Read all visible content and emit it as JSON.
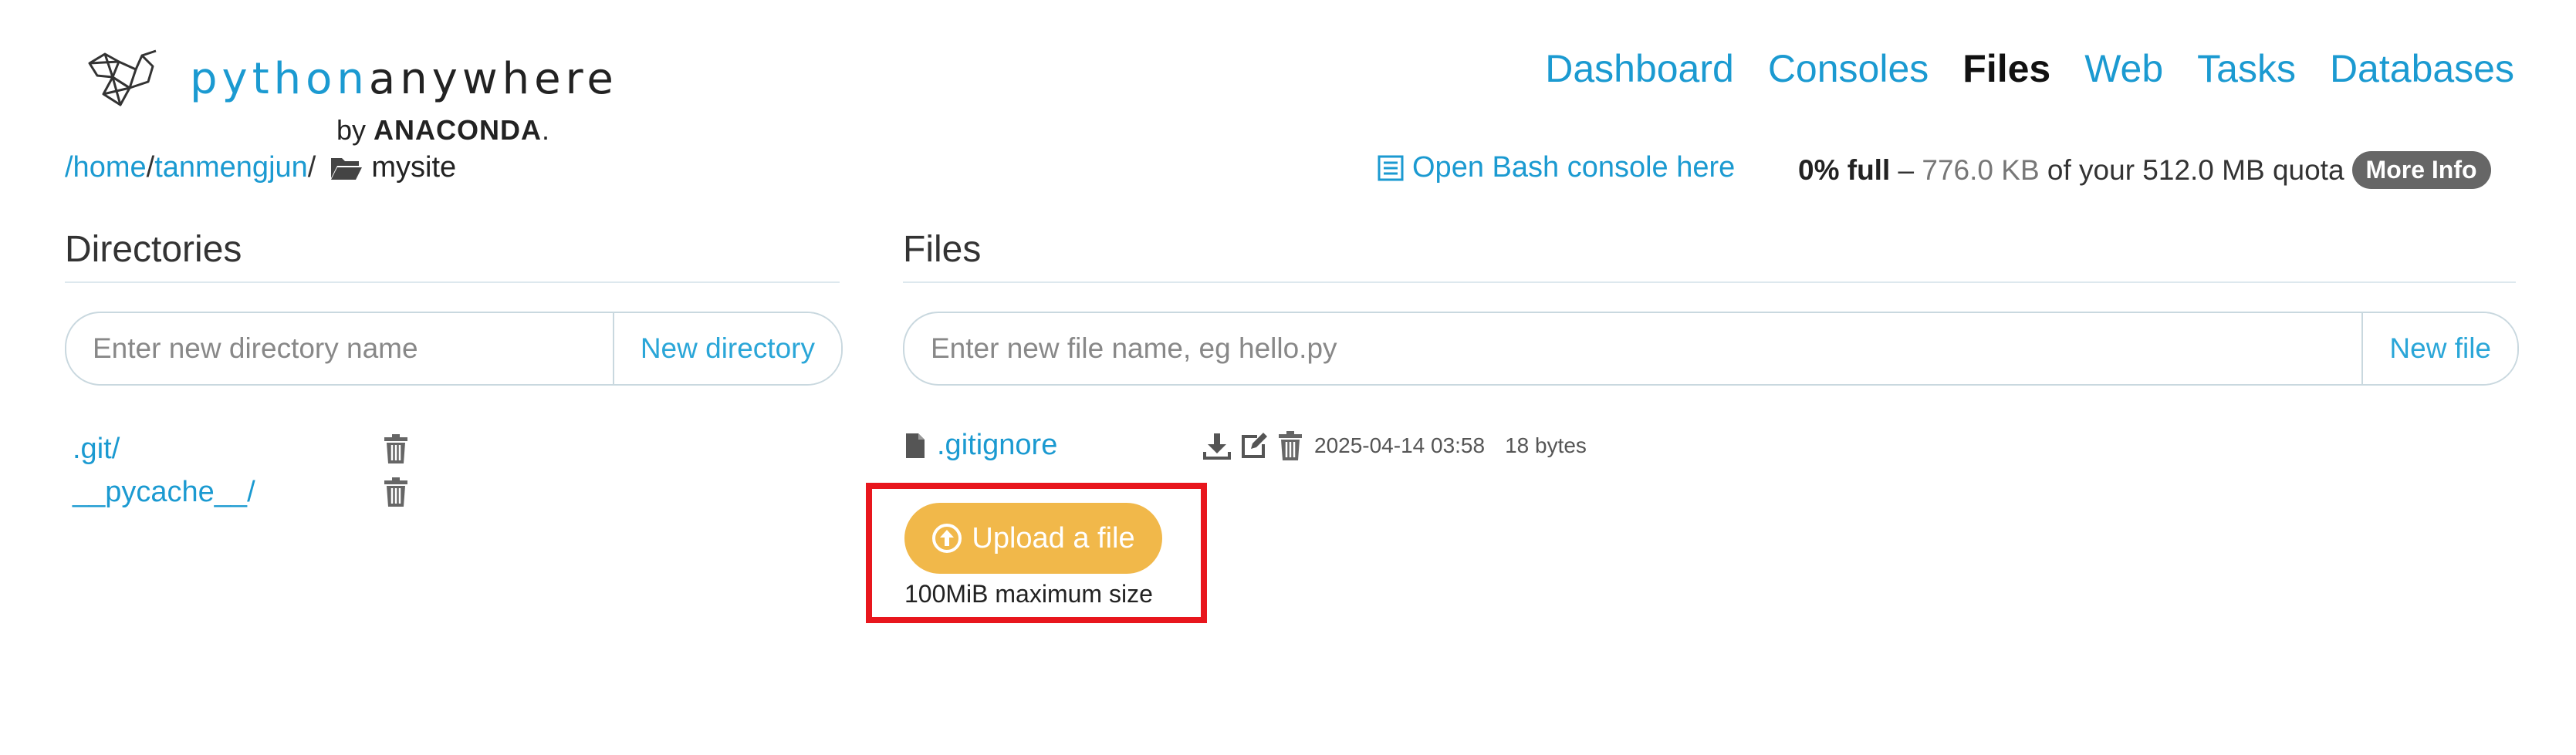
{
  "app": {
    "brand_python": "python",
    "brand_anywhere": "anywhere",
    "by_prefix": "by",
    "by_company": "ANACONDA",
    "by_suffix": "."
  },
  "nav": {
    "items": [
      {
        "label": "Dashboard",
        "active": false
      },
      {
        "label": "Consoles",
        "active": false
      },
      {
        "label": "Files",
        "active": true
      },
      {
        "label": "Web",
        "active": false
      },
      {
        "label": "Tasks",
        "active": false
      },
      {
        "label": "Databases",
        "active": false
      }
    ]
  },
  "breadcrumb": {
    "parts": [
      "/home",
      "/",
      "tanmengjun",
      "/"
    ],
    "current": "mysite",
    "folder_icon": "folder-open-icon"
  },
  "console": {
    "label": "Open Bash console here",
    "icon": "console-icon"
  },
  "quota": {
    "percent": "0% full",
    "dash": " – ",
    "used": "776.0 KB",
    "middle": " of your 512.0 MB quota",
    "more_label": "More Info"
  },
  "directories": {
    "heading": "Directories",
    "input_placeholder": "Enter new directory name",
    "new_button": "New directory",
    "items": [
      ".git/",
      "__pycache__/"
    ]
  },
  "files": {
    "heading": "Files",
    "input_placeholder": "Enter new file name, eg hello.py",
    "new_button": "New file",
    "items": [
      {
        "name": ".gitignore",
        "date": "2025-04-14 03:58",
        "size": "18 bytes"
      }
    ]
  },
  "upload": {
    "label": "Upload a file",
    "note": "100MiB maximum size",
    "highlight_color": "#e8161d"
  },
  "colors": {
    "link": "#1b9ad1",
    "upload_button": "#f1b84a",
    "more_info_badge": "#666666"
  }
}
